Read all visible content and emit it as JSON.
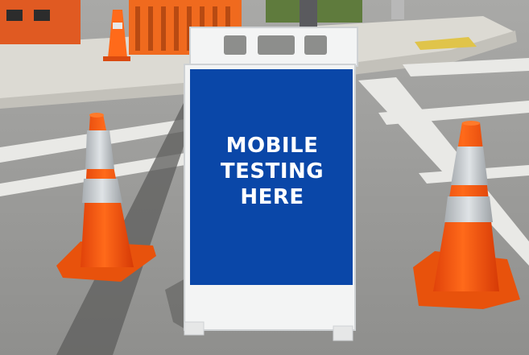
{
  "photo": {
    "sign": {
      "lines": [
        "MOBILE",
        "TESTING",
        "HERE"
      ],
      "panel_color": "#0a47a8",
      "frame_color": "#f3f4f4"
    },
    "cone_color": "#ff5a0a",
    "road_color": "#9b9b9b"
  }
}
